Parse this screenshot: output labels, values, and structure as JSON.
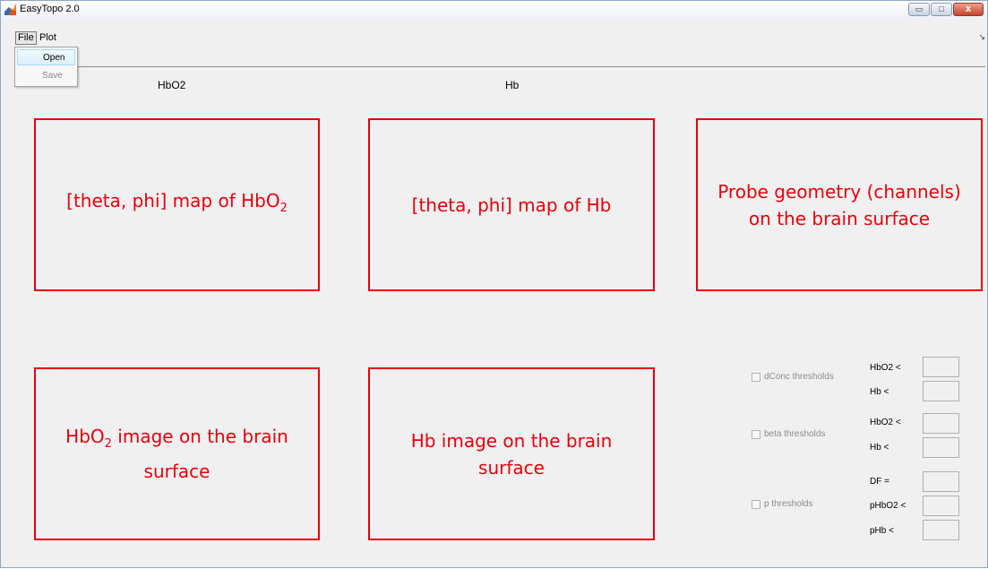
{
  "window": {
    "title": "EasyTopo 2.0",
    "icon": "matlab-logo-icon"
  },
  "window_buttons": {
    "minimize": "▭",
    "maximize": "□",
    "close": "x"
  },
  "menubar": {
    "file": "File",
    "plot": "Plot",
    "overflow": "↘"
  },
  "file_menu": {
    "open": "Open",
    "save": "Save"
  },
  "headers": {
    "hbo2": "HbO2",
    "hb": "Hb"
  },
  "panels": {
    "map_hbo2": {
      "text": "[theta, phi] map of HbO",
      "sub": "2"
    },
    "map_hb": {
      "text": "[theta, phi] map of Hb"
    },
    "probe": {
      "line1": "Probe geometry (channels)",
      "line2": "on the brain surface"
    },
    "image_hbo2": {
      "line1a": "HbO",
      "line1sub": "2",
      "line1b": " image on the brain",
      "line2": "surface"
    },
    "image_hb": {
      "line1": "Hb image on the brain",
      "line2": "surface"
    }
  },
  "thresholds": {
    "dconc": {
      "label": "dConc thresholds",
      "checked": false,
      "hbo2": "HbO2 <",
      "hb": "Hb <"
    },
    "beta": {
      "label": "beta thresholds",
      "checked": false,
      "hbo2": "HbO2 <",
      "hb": "Hb <"
    },
    "p": {
      "label": "p thresholds",
      "checked": false,
      "df": "DF =",
      "phbo2": "pHbO2 <",
      "phb": "pHb <"
    }
  },
  "colors": {
    "annotation": "#e8000b",
    "background": "#f0f0f0"
  }
}
